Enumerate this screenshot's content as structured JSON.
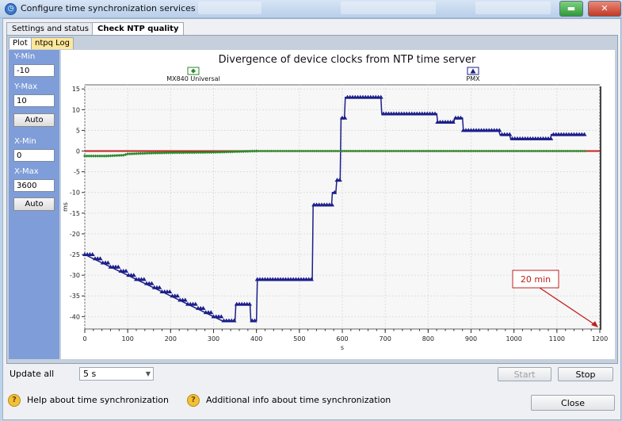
{
  "window": {
    "title": "Configure time synchronization services",
    "min_glyph": "▬",
    "close_glyph": "✕"
  },
  "tabs": [
    {
      "label": "Settings and status",
      "selected": false
    },
    {
      "label": "Check NTP quality",
      "selected": true
    }
  ],
  "subtabs": [
    {
      "label": "Plot",
      "selected": true
    },
    {
      "label": "ntpq Log",
      "selected": false
    }
  ],
  "sidebar": {
    "ymin_label": "Y-Min",
    "ymin_value": "-10",
    "ymax_label": "Y-Max",
    "ymax_value": "10",
    "y_auto": "Auto",
    "xmin_label": "X-Min",
    "xmin_value": "0",
    "xmax_label": "X-Max",
    "xmax_value": "3600",
    "x_auto": "Auto"
  },
  "chart_data": {
    "type": "line",
    "title": "Divergence of device clocks from NTP time server",
    "xlabel": "s",
    "ylabel": "ms",
    "xlim": [
      0,
      1200
    ],
    "ylim": [
      -43,
      16
    ],
    "x_ticks": [
      0,
      100,
      200,
      300,
      400,
      500,
      600,
      700,
      800,
      900,
      1000,
      1100,
      1200
    ],
    "y_ticks": [
      15,
      10,
      5,
      0,
      -5,
      -10,
      -15,
      -20,
      -25,
      -30,
      -35,
      -40
    ],
    "grid": true,
    "legend": [
      {
        "name": "MX840 Universal",
        "color": "#2a8a2a",
        "marker": "diamond",
        "placement": "top-left"
      },
      {
        "name": "PMX",
        "color": "#1c1f8a",
        "marker": "triangle",
        "placement": "top-right"
      }
    ],
    "reference_line": {
      "y": 0,
      "color": "#c0201c"
    },
    "series": [
      {
        "name": "PMX",
        "color": "#1c1f8a",
        "points": [
          [
            0,
            -25
          ],
          [
            20,
            -26
          ],
          [
            40,
            -27
          ],
          [
            60,
            -28
          ],
          [
            80,
            -29
          ],
          [
            100,
            -30
          ],
          [
            120,
            -31
          ],
          [
            140,
            -32
          ],
          [
            160,
            -33
          ],
          [
            180,
            -34
          ],
          [
            200,
            -35
          ],
          [
            220,
            -36
          ],
          [
            240,
            -37
          ],
          [
            260,
            -38
          ],
          [
            280,
            -39
          ],
          [
            300,
            -40
          ],
          [
            320,
            -41
          ],
          [
            350,
            -41
          ],
          [
            352,
            -37
          ],
          [
            385,
            -37
          ],
          [
            387,
            -41
          ],
          [
            400,
            -41
          ],
          [
            402,
            -31
          ],
          [
            530,
            -31
          ],
          [
            532,
            -13
          ],
          [
            575,
            -13
          ],
          [
            577,
            -10
          ],
          [
            585,
            -10
          ],
          [
            587,
            -7
          ],
          [
            595,
            -7
          ],
          [
            597,
            8
          ],
          [
            605,
            8
          ],
          [
            607,
            13
          ],
          [
            690,
            13
          ],
          [
            692,
            9
          ],
          [
            820,
            9
          ],
          [
            822,
            7
          ],
          [
            860,
            7
          ],
          [
            862,
            8
          ],
          [
            880,
            8
          ],
          [
            882,
            5
          ],
          [
            965,
            5
          ],
          [
            967,
            4
          ],
          [
            990,
            4
          ],
          [
            992,
            3
          ],
          [
            1085,
            3
          ],
          [
            1087,
            4
          ],
          [
            1165,
            4
          ]
        ]
      },
      {
        "name": "MX840 Universal",
        "color": "#2a8a2a",
        "points": [
          [
            0,
            -1.2
          ],
          [
            50,
            -1.2
          ],
          [
            90,
            -1.0
          ],
          [
            100,
            -0.7
          ],
          [
            150,
            -0.5
          ],
          [
            200,
            -0.4
          ],
          [
            300,
            -0.3
          ],
          [
            400,
            0
          ],
          [
            500,
            0
          ],
          [
            600,
            0
          ],
          [
            700,
            0
          ],
          [
            800,
            0
          ],
          [
            900,
            0
          ],
          [
            1000,
            0
          ],
          [
            1100,
            0
          ],
          [
            1165,
            0
          ]
        ]
      }
    ],
    "annotation": {
      "text": "20 min",
      "color": "#c0201c",
      "target_x": 1200,
      "target_y": -43
    }
  },
  "bottom": {
    "update_label": "Update all",
    "update_value": "5 s",
    "start_label": "Start",
    "stop_label": "Stop",
    "help1": "Help about time synchronization",
    "help2": "Additional info about time synchronization",
    "close_label": "Close"
  }
}
